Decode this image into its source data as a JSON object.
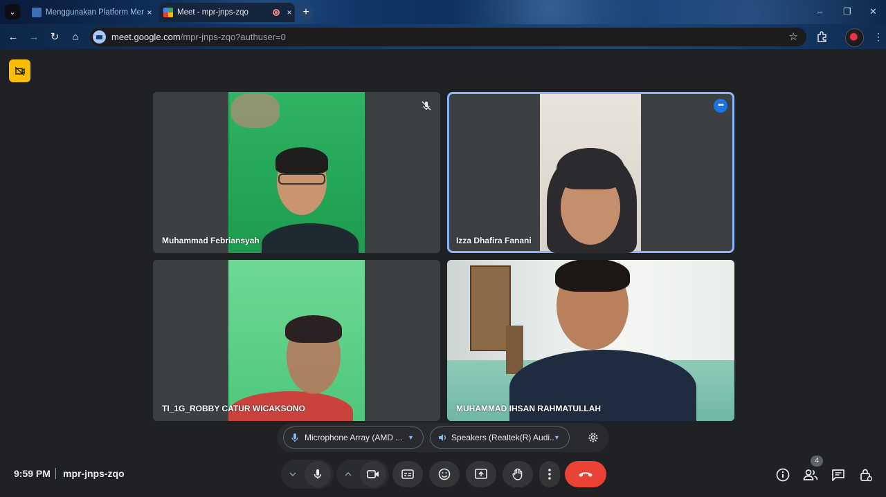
{
  "browser": {
    "tabs": [
      {
        "title": "Menggunakan Platform Merdeka",
        "close": "×"
      },
      {
        "title": "Meet - mpr-jnps-zqo",
        "close": "×"
      }
    ],
    "new_tab": "+",
    "window_controls": [
      "–",
      "❐",
      "✕"
    ],
    "url_host": "meet.google.com",
    "url_path": "/mpr-jnps-zqo?authuser=0"
  },
  "meet": {
    "tiles": [
      {
        "name": "Muhammad Febriansyah",
        "muted": true
      },
      {
        "name": "Izza Dhafira Fanani",
        "active_speaker": true
      },
      {
        "name": "TI_1G_ROBBY CATUR WICAKSONO"
      },
      {
        "name": "MUHAMMAD IHSAN RAHMATULLAH"
      }
    ],
    "devices": {
      "microphone": "Microphone Array (AMD ...",
      "speakers": "Speakers (Realtek(R) Audi..."
    },
    "footer": {
      "time": "9:59 PM",
      "meeting_code": "mpr-jnps-zqo",
      "participants_count": "4"
    },
    "colors": {
      "accent": "#8ab4f8",
      "end_call": "#ea4335",
      "notice": "#fbbc04"
    }
  }
}
